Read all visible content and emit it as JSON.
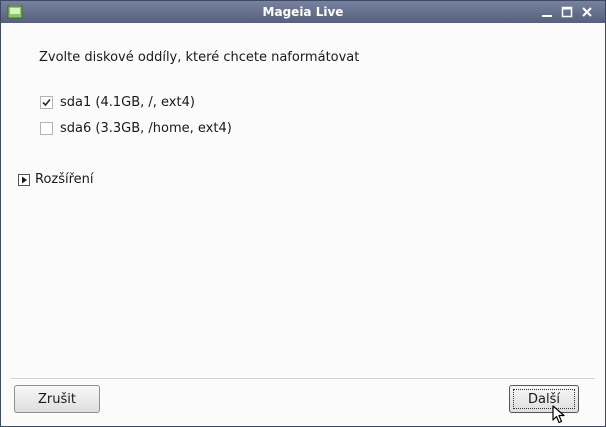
{
  "window": {
    "title": "Mageia Live"
  },
  "main": {
    "prompt": "Zvolte diskové oddíly, které chcete naformátovat",
    "partitions": [
      {
        "label": "sda1 (4.1GB, /, ext4)",
        "checked": true
      },
      {
        "label": "sda6 (3.3GB, /home, ext4)",
        "checked": false
      }
    ],
    "advanced_label": "Rozšíření"
  },
  "buttons": {
    "cancel": "Zrušit",
    "next": "Další"
  },
  "icons": {
    "app": "mageia-app-icon",
    "minimize": "minimize-icon",
    "maximize": "maximize-icon",
    "close": "close-icon",
    "expander": "triangle-right-icon",
    "check": "checkmark-icon",
    "cursor": "mouse-pointer-icon"
  },
  "colors": {
    "titlebar": "#5d6885",
    "background": "#fbfbfb",
    "text": "#1a1a1a"
  }
}
